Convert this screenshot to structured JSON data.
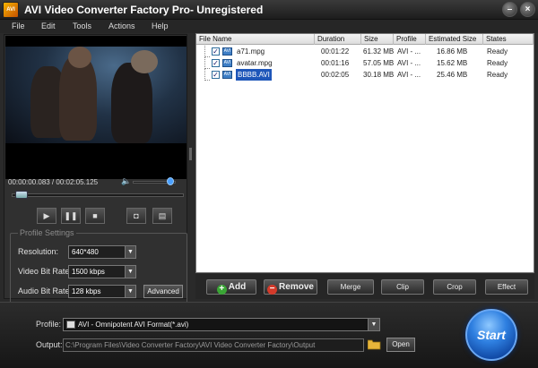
{
  "window": {
    "title": "AVI Video Converter Factory Pro- Unregistered",
    "app_icon_label": "AVI"
  },
  "menu": [
    "File",
    "Edit",
    "Tools",
    "Actions",
    "Help"
  ],
  "player": {
    "timecode": "00:00:00.083 / 00:02:05.125",
    "progress_fraction": 0.02,
    "volume_fraction": 0.95,
    "buttons": [
      "play",
      "pause",
      "stop",
      "snapshot",
      "folder"
    ]
  },
  "profile_settings": {
    "legend": "Profile Settings",
    "resolution_label": "Resolution:",
    "resolution_value": "640*480",
    "video_bitrate_label": "Video Bit Rate:",
    "video_bitrate_value": "1500 kbps",
    "audio_bitrate_label": "Audio Bit Rate:",
    "audio_bitrate_value": "128 kbps",
    "advanced_label": "Advanced"
  },
  "file_list": {
    "columns": [
      "File Name",
      "Duration",
      "Size",
      "Profile",
      "Estimated Size",
      "States"
    ],
    "rows": [
      {
        "name": "a71.mpg",
        "duration": "00:01:22",
        "size": "61.32 MB",
        "profile": "AVI - ...",
        "estimated": "16.86 MB",
        "state": "Ready",
        "checked": true,
        "selected": false
      },
      {
        "name": "avatar.mpg",
        "duration": "00:01:16",
        "size": "57.05 MB",
        "profile": "AVI - ...",
        "estimated": "15.62 MB",
        "state": "Ready",
        "checked": true,
        "selected": false
      },
      {
        "name": "BBBB.AVI",
        "duration": "00:02:05",
        "size": "30.18 MB",
        "profile": "AVI - ...",
        "estimated": "25.46 MB",
        "state": "Ready",
        "checked": true,
        "selected": true
      }
    ]
  },
  "actions": {
    "add": "Add",
    "remove": "Remove",
    "merge": "Merge",
    "clip": "Clip",
    "crop": "Crop",
    "effect": "Effect"
  },
  "output": {
    "profile_label": "Profile:",
    "profile_value": "AVI - Omnipotent AVI Format(*.avi)",
    "output_label": "Output:",
    "output_path": "C:\\Program Files\\Video Converter Factory\\AVI Video Converter Factory\\Output",
    "open_label": "Open",
    "start_label": "Start"
  },
  "colors": {
    "accent": "#2e7fe0",
    "selection": "#1e56b9",
    "add_green": "#3aa635",
    "remove_red": "#d43a2a"
  }
}
